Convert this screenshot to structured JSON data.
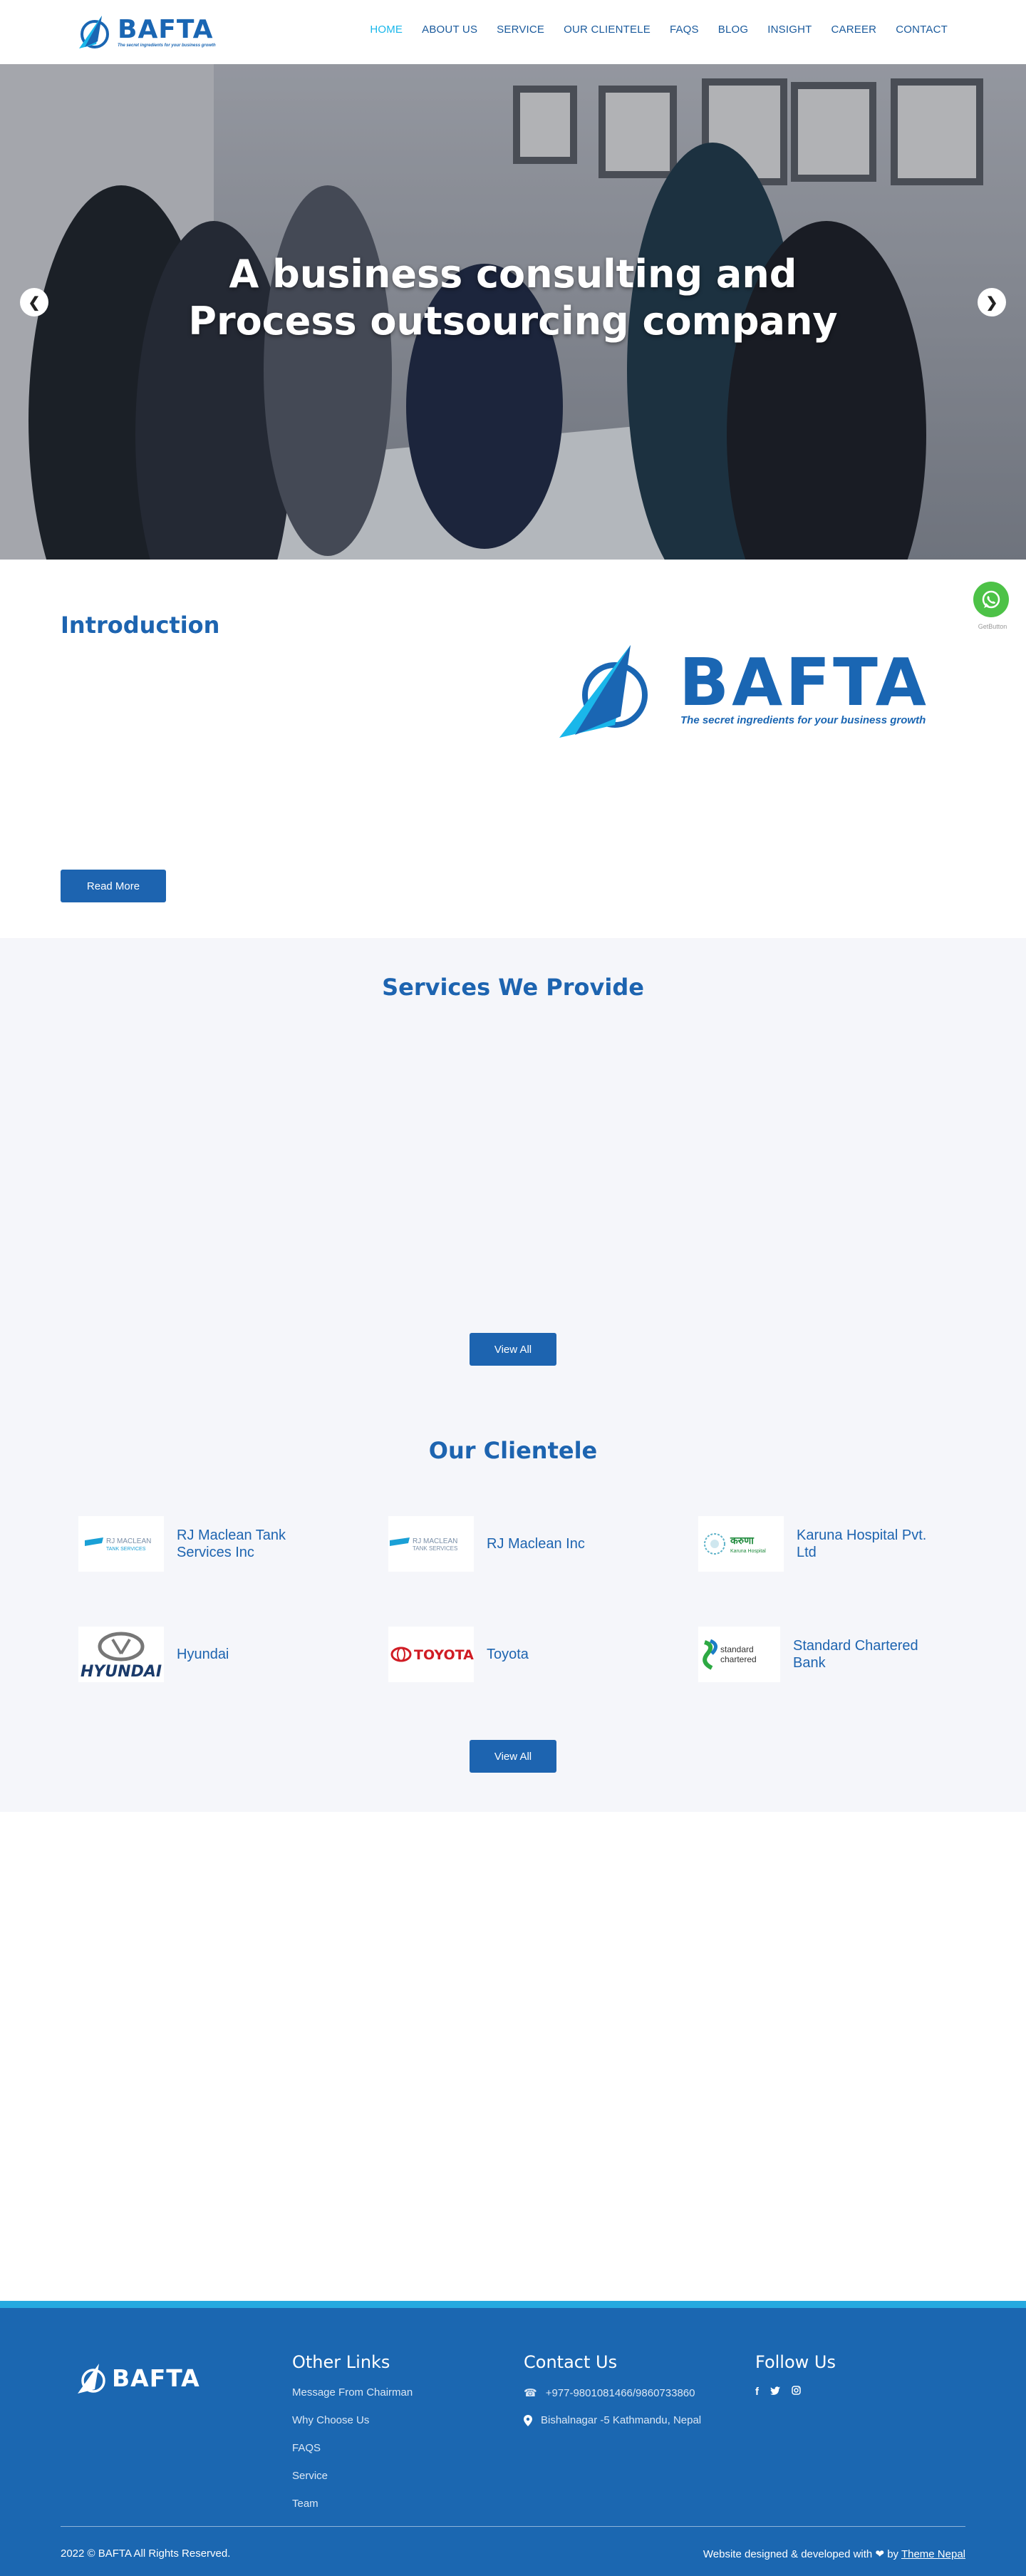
{
  "header": {
    "logo_word": "BAFTA",
    "logo_tagline": "The secret ingredients for your business growth",
    "nav": [
      "HOME",
      "ABOUT US",
      "SERVICE",
      "OUR CLIENTELE",
      "FAQS",
      "BLOG",
      "INSIGHT",
      "CAREER",
      "CONTACT"
    ],
    "active_nav": "HOME",
    "nav_color": "#1a5a9c",
    "active_color": "#1ab7ea"
  },
  "hero": {
    "title_line1": "A business consulting and",
    "title_line2": "Process outsourcing company"
  },
  "whatsapp": {
    "label": "GetButton"
  },
  "intro": {
    "title": "Introduction",
    "logo_word": "BAFTA",
    "logo_tagline": "The secret ingredients for your business growth",
    "read_more": "Read More"
  },
  "services": {
    "title": "Services We Provide",
    "view_all": "View All"
  },
  "clientele": {
    "title": "Our Clientele",
    "clients": [
      {
        "name": "RJ Maclean Tank Services Inc",
        "logo_text": "RJ MACLEAN"
      },
      {
        "name": "RJ Maclean Inc",
        "logo_text": "RJ MACLEAN"
      },
      {
        "name": "Karuna Hospital Pvt. Ltd",
        "logo_text": "करुणा"
      },
      {
        "name": "Hyundai",
        "logo_text": "HYUNDAI"
      },
      {
        "name": "Toyota",
        "logo_text": "TOYOTA"
      },
      {
        "name": "Standard Chartered Bank",
        "logo_text": "standard chartered"
      }
    ],
    "view_all": "View All"
  },
  "footer": {
    "logo_word": "BAFTA",
    "other_links_title": "Other Links",
    "other_links": [
      "Message From Chairman",
      "Why Choose Us",
      "FAQS",
      "Service",
      "Team"
    ],
    "contact_title": "Contact Us",
    "phone": "+977-9801081466/9860733860",
    "address": "Bishalnagar -5 Kathmandu, Nepal",
    "follow_title": "Follow Us",
    "copyright": "2022 © BAFTA All Rights Reserved.",
    "credit_prefix": "Website designed & developed with",
    "credit_by": "by",
    "credit_name": "Theme Nepal",
    "brand_color": "#1b67b1",
    "accent_color": "#25a9e0"
  }
}
